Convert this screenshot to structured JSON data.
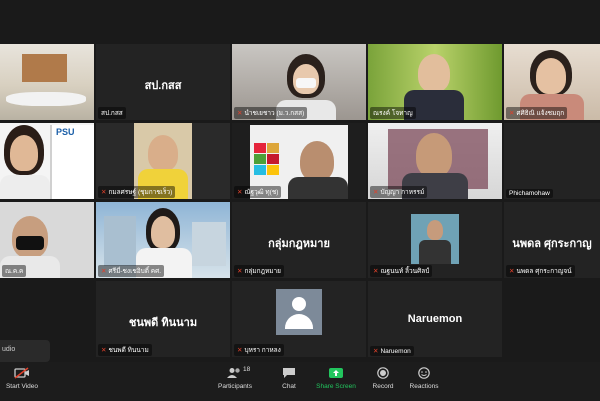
{
  "tiles": [
    {
      "name": "",
      "display": ""
    },
    {
      "name": "สป.กสส",
      "display": "สป.กสส"
    },
    {
      "name": "นำชเยชาว (ม.ว.กสส)",
      "display": ""
    },
    {
      "name": "ณรงค์ โจทาญ",
      "display": ""
    },
    {
      "name": "ศศิธิณิ แจ้งชมฤก",
      "display": ""
    },
    {
      "name": "",
      "display": ""
    },
    {
      "name": "กมลศรษฐ์ (ชุมกาชเร็ว)",
      "display": ""
    },
    {
      "name": "ณัฐวุฒิ ทุ(ช)",
      "display": ""
    },
    {
      "name": "บัญญา กาหรรม์",
      "display": ""
    },
    {
      "name": "Phichamohaw",
      "display": ""
    },
    {
      "name": "ณ.ค.ค",
      "display": ""
    },
    {
      "name": "ศรีมี่-ชงเชอิบติ์ คศ.",
      "display": ""
    },
    {
      "name": "กลุ่มกฎหมาย",
      "display": "กลุ่มกฎหมาย"
    },
    {
      "name": "ณฐนนท์ ลิ้วนศิลป์",
      "display": ""
    },
    {
      "name": "นพดล ศุกระกาญจน์",
      "display": "นพดล ศุกระกาญ"
    },
    {
      "name": "ชนพดี ทินนาม",
      "display": "ชนพดี ทินนาม"
    },
    {
      "name": "บุหรา กาหลง",
      "display": ""
    },
    {
      "name": "Naruemon",
      "display": "Naruemon"
    }
  ],
  "toolbar": {
    "audio_popup": "udio",
    "start_video": "Start Video",
    "participants": "Participants",
    "participants_count": "18",
    "chat": "Chat",
    "share_screen": "Share Screen",
    "record": "Record",
    "reactions": "Reactions"
  },
  "colors": {
    "share_green": "#22c55e",
    "mute_red": "#e0412b"
  }
}
